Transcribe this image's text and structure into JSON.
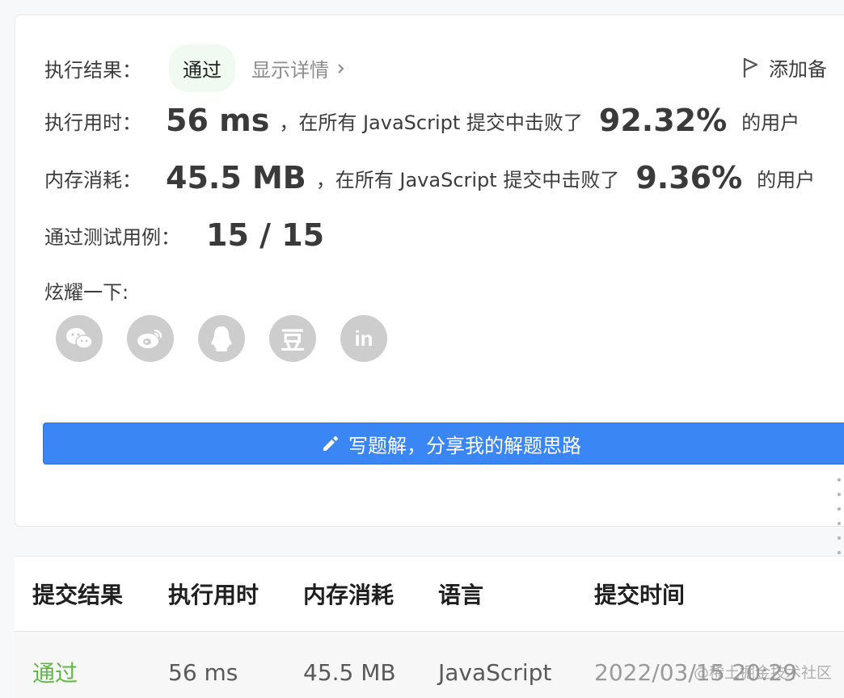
{
  "result": {
    "label": "执行结果：",
    "status": "通过",
    "details_link": "显示详情",
    "add_note": "添加备"
  },
  "runtime": {
    "label": "执行用时：",
    "value": "56 ms",
    "text": "，在所有 JavaScript 提交中击败了",
    "percent": "92.32%",
    "suffix": "的用户"
  },
  "memory": {
    "label": "内存消耗：",
    "value": "45.5 MB",
    "text": "，在所有 JavaScript 提交中击败了",
    "percent": "9.36%",
    "suffix": "的用户"
  },
  "tests": {
    "label": "通过测试用例：",
    "value": "15 / 15"
  },
  "share": {
    "label": "炫耀一下:",
    "icons": [
      "wechat-icon",
      "weibo-icon",
      "qq-icon",
      "douban-icon",
      "linkedin-icon"
    ],
    "douban_glyph": "豆",
    "linkedin_glyph": "in"
  },
  "write_solution": {
    "label": "写题解，分享我的解题思路"
  },
  "submissions": {
    "headers": [
      "提交结果",
      "执行用时",
      "内存消耗",
      "语言",
      "提交时间"
    ],
    "rows": [
      {
        "status": "通过",
        "runtime": "56 ms",
        "memory": "45.5 MB",
        "language": "JavaScript",
        "time": "2022/03/15 20:29"
      }
    ]
  },
  "watermark": "@稀土掘金技术社区",
  "colors": {
    "accent_blue": "#3a86f5",
    "pass_green": "#5fb841",
    "icon_gray": "#cdcdcd"
  }
}
